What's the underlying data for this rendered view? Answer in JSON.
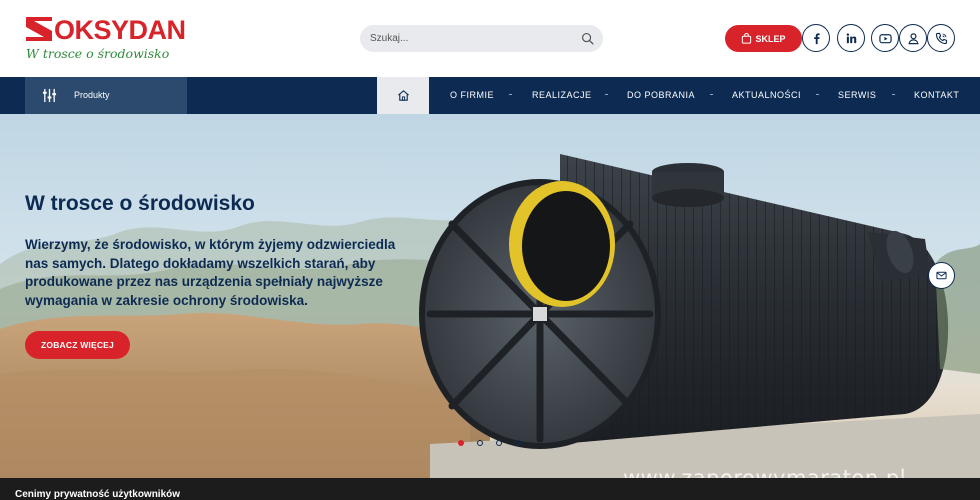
{
  "brand": {
    "name": "OKSYDAN",
    "tagline": "W trosce o środowisko",
    "color_red": "#d8232a",
    "color_navy": "#0d2b52",
    "color_green": "#2e8a3b"
  },
  "search": {
    "placeholder": "Szukaj...",
    "icon": "magnifier-icon"
  },
  "header_actions": {
    "shop_label": "SKLEP",
    "shop_icon": "shopping-bag-icon",
    "icons": [
      "facebook-icon",
      "linkedin-icon",
      "youtube-icon",
      "user-icon",
      "phone-icon"
    ]
  },
  "nav": {
    "products_label": "Produkty",
    "products_icon": "sliders-icon",
    "home_icon": "home-icon",
    "items": [
      "O FIRMIE",
      "REALIZACJE",
      "DO POBRANIA",
      "AKTUALNOŚCI",
      "SERWIS",
      "KONTAKT"
    ]
  },
  "hero": {
    "title": "W trosce o środowisko",
    "text": "Wierzymy, że środowisko, w którym żyjemy odzwierciedla nas samych. Dlatego dokładamy wszelkich starań, aby produkowane przez nas urządzenia spełniały najwyższe wymagania w zakresie ochrony środowiska.",
    "button": "ZOBACZ WIĘCEJ",
    "slides_total": 4,
    "slide_active": 1,
    "mail_icon": "envelope-icon",
    "watermark": "www.zaporowymaraton.pl"
  },
  "cookie": {
    "title": "Cenimy prywatność użytkowników"
  }
}
